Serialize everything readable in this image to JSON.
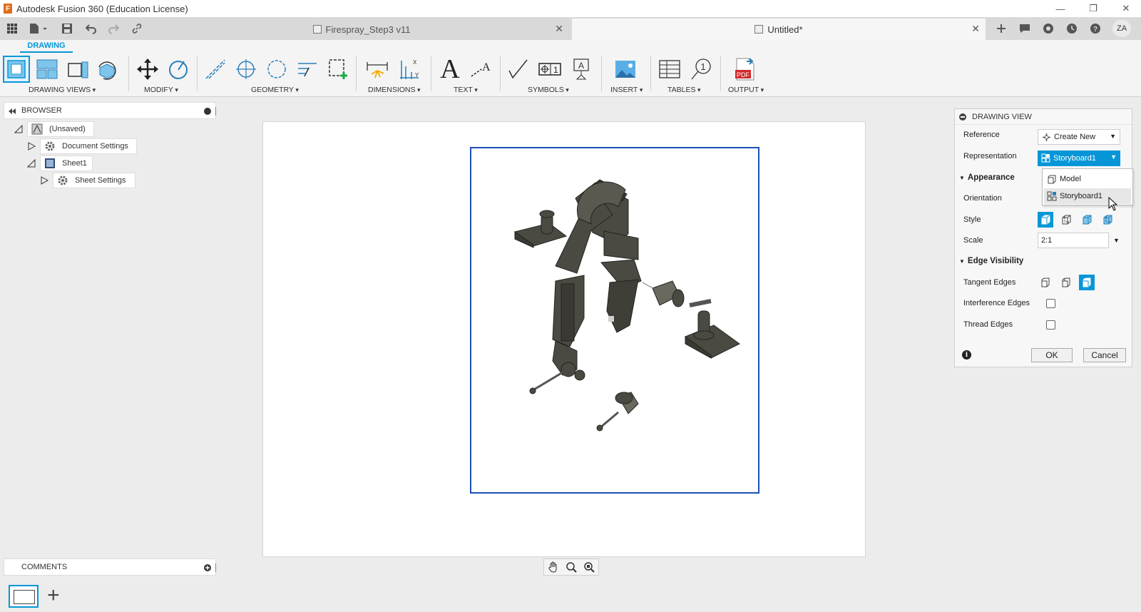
{
  "window": {
    "title": "Autodesk Fusion 360 (Education License)",
    "logo_letter": "F",
    "minimize_glyph": "—",
    "maximize_glyph": "❐",
    "close_glyph": "✕"
  },
  "tabs": [
    {
      "label": "Firespray_Step3 v11",
      "close": "✕",
      "active": false
    },
    {
      "label": "Untitled*",
      "close": "✕",
      "active": true
    }
  ],
  "user": {
    "initials": "ZA"
  },
  "ribbon": {
    "workspace_tab": "DRAWING",
    "groups": [
      {
        "label": "DRAWING VIEWS"
      },
      {
        "label": "MODIFY"
      },
      {
        "label": "GEOMETRY"
      },
      {
        "label": "DIMENSIONS"
      },
      {
        "label": "TEXT"
      },
      {
        "label": "SYMBOLS"
      },
      {
        "label": "INSERT"
      },
      {
        "label": "TABLES"
      },
      {
        "label": "OUTPUT"
      }
    ],
    "text_tool_glyph": "A",
    "pdf_label": "PDF",
    "balloon_number": "1"
  },
  "browser": {
    "title": "BROWSER",
    "items": [
      {
        "label": "(Unsaved)"
      },
      {
        "label": "Document Settings"
      },
      {
        "label": "Sheet1"
      },
      {
        "label": "Sheet Settings"
      }
    ]
  },
  "comments": {
    "title": "COMMENTS"
  },
  "dialog": {
    "title": "DRAWING VIEW",
    "reference_label": "Reference",
    "reference_value": "Create New",
    "representation_label": "Representation",
    "representation_value": "Storyboard1",
    "appearance_section": "Appearance",
    "orientation_label": "Orientation",
    "style_label": "Style",
    "scale_label": "Scale",
    "scale_value": "2:1",
    "edge_section": "Edge Visibility",
    "tangent_label": "Tangent Edges",
    "interference_label": "Interference Edges",
    "interference_checked": false,
    "thread_label": "Thread Edges",
    "thread_checked": false,
    "ok_label": "OK",
    "cancel_label": "Cancel",
    "info_glyph": "i"
  },
  "dropdown": {
    "options": [
      {
        "label": "Model"
      },
      {
        "label": "Storyboard1"
      }
    ],
    "hovered": "Storyboard1"
  },
  "sheetbar": {
    "add_glyph": "+"
  },
  "colors": {
    "accent": "#0696d7",
    "view_frame": "#1c4fb4",
    "pdf_red": "#d12a2a",
    "model_metal": "#4b4a42"
  }
}
